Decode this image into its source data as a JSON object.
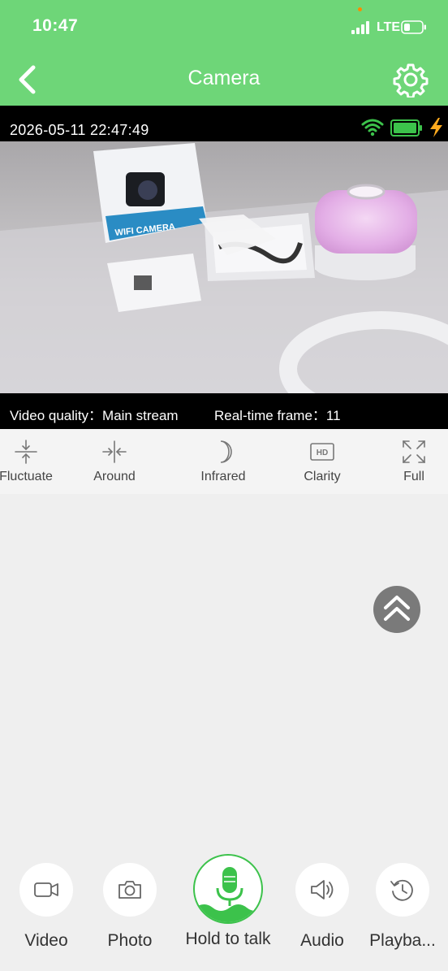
{
  "status_bar": {
    "time": "10:47",
    "network": "LTE"
  },
  "navbar": {
    "title": "Camera"
  },
  "video": {
    "timestamp": "2026-05-11 22:47:49",
    "quality_label": "Video quality：Main stream",
    "frame_label": "Real-time frame：11",
    "feed_box_text": "WIFI CAMERA"
  },
  "tools": [
    {
      "label": "Fluctuate",
      "icon": "fluctuate-icon"
    },
    {
      "label": "Around",
      "icon": "around-icon"
    },
    {
      "label": "Infrared",
      "icon": "moon-icon"
    },
    {
      "label": "Clarity",
      "icon": "hd-icon"
    },
    {
      "label": "Full",
      "icon": "fullscreen-icon"
    }
  ],
  "bottom_actions": [
    {
      "label": "Video",
      "icon": "video-camera-icon"
    },
    {
      "label": "Photo",
      "icon": "camera-icon"
    },
    {
      "label": "Hold to talk",
      "icon": "microphone-icon"
    },
    {
      "label": "Audio",
      "icon": "speaker-icon"
    },
    {
      "label": "Playba...",
      "icon": "history-icon"
    }
  ],
  "colors": {
    "accent": "#6ed678",
    "talk_green": "#3cc24b"
  }
}
